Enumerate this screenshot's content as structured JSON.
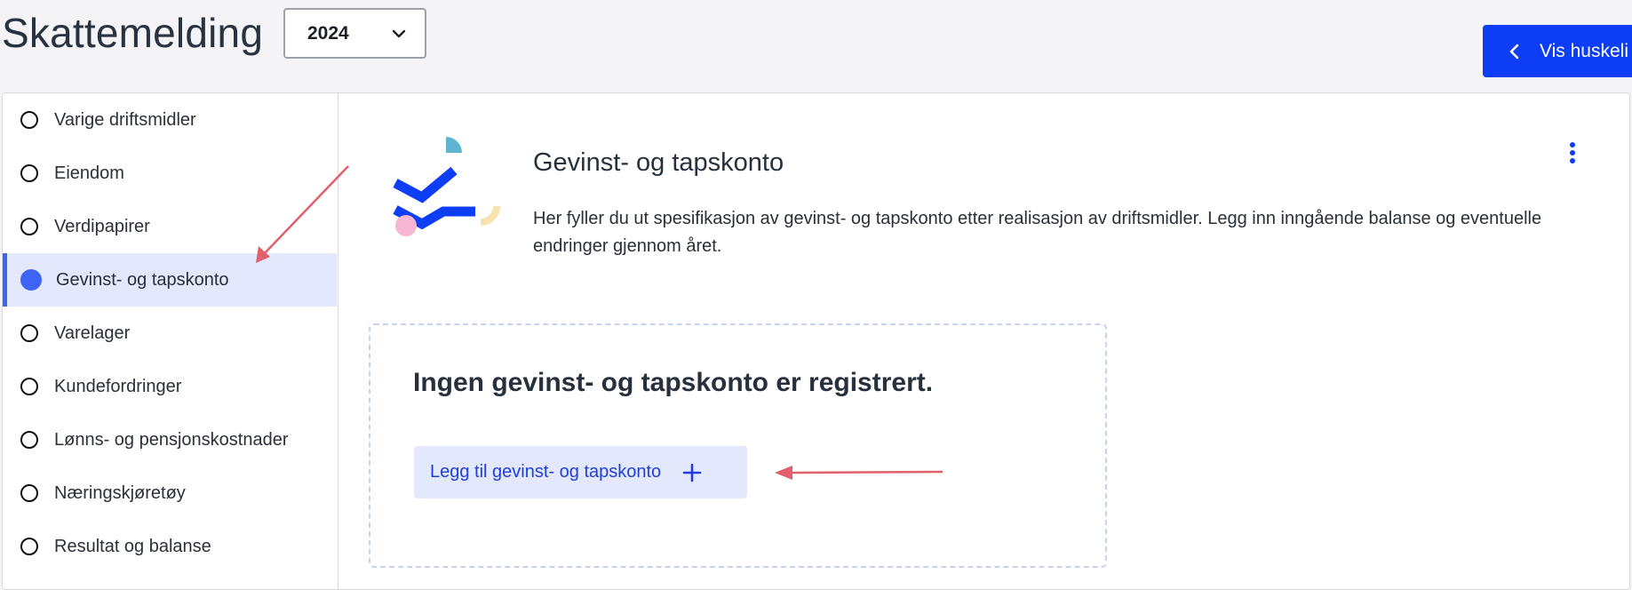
{
  "header": {
    "title": "Skattemelding",
    "year_select": {
      "value": "2024"
    },
    "vis_button_label": "Vis huskeli"
  },
  "sidebar": {
    "items": [
      {
        "label": "Varige driftsmidler",
        "active": false
      },
      {
        "label": "Eiendom",
        "active": false
      },
      {
        "label": "Verdipapirer",
        "active": false
      },
      {
        "label": "Gevinst- og tapskonto",
        "active": true
      },
      {
        "label": "Varelager",
        "active": false
      },
      {
        "label": "Kundefordringer",
        "active": false
      },
      {
        "label": "Lønns- og pensjonskostnader",
        "active": false
      },
      {
        "label": "Næringskjøretøy",
        "active": false
      },
      {
        "label": "Resultat og balanse",
        "active": false
      }
    ]
  },
  "main": {
    "section_title": "Gevinst- og tapskonto",
    "section_description": "Her fyller du ut spesifikasjon av gevinst- og tapskonto etter realisasjon av driftsmidler. Legg inn inngående balanse og eventuelle endringer gjennom året.",
    "empty_state": {
      "title": "Ingen gevinst- og tapskonto er registrert.",
      "add_button_label": "Legg til gevinst- og tapskonto"
    }
  },
  "colors": {
    "accent": "#0d3df5",
    "active_bg": "#e3e8fc",
    "annotation_arrow": "#e0606b"
  }
}
